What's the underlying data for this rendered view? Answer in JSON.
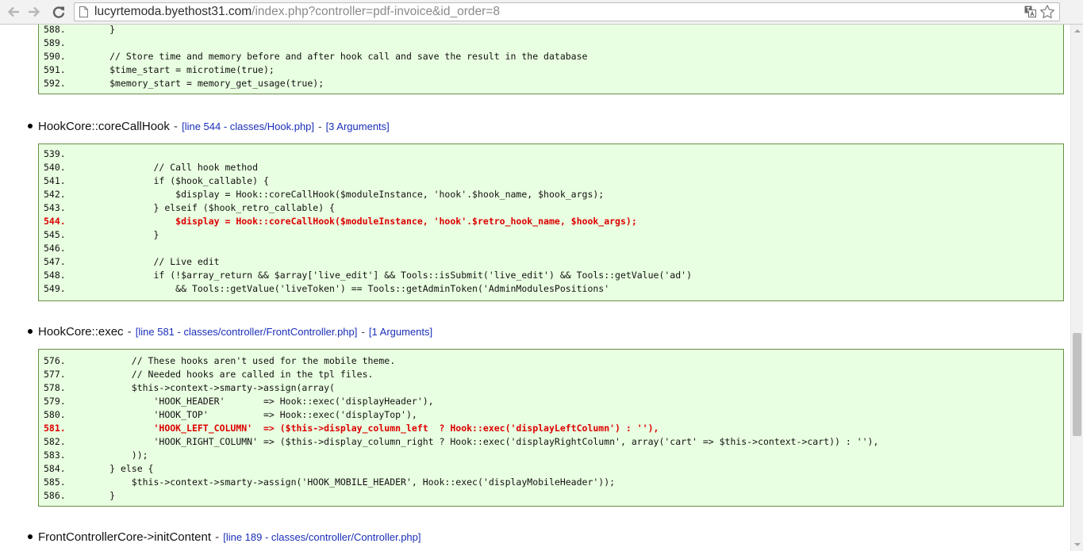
{
  "browser": {
    "url_host": "lucyrtemoda.byethost31.com",
    "url_path": "/index.php?controller=pdf-invoice&id_order=8",
    "icons": {
      "back": "back-arrow-icon",
      "forward": "forward-arrow-icon",
      "reload": "reload-icon",
      "page": "page-icon",
      "translate": "translate-icon",
      "bookmark": "star-icon"
    }
  },
  "frames": [
    {
      "lines": [
        {
          "num": "588.",
          "code": "        }",
          "highlight": false
        },
        {
          "num": "589.",
          "code": "",
          "highlight": false
        },
        {
          "num": "590.",
          "code": "        // Store time and memory before and after hook call and save the result in the database",
          "highlight": false
        },
        {
          "num": "591.",
          "code": "        $time_start = microtime(true);",
          "highlight": false
        },
        {
          "num": "592.",
          "code": "        $memory_start = memory_get_usage(true);",
          "highlight": false
        }
      ]
    },
    {
      "function": "HookCore::coreCallHook",
      "separator": "-",
      "file_link": "[line 544 - classes/Hook.php]",
      "link_separator": "-",
      "args_link": "[3 Arguments]",
      "lines": [
        {
          "num": "539.",
          "code": "",
          "highlight": false
        },
        {
          "num": "540.",
          "code": "                // Call hook method",
          "highlight": false
        },
        {
          "num": "541.",
          "code": "                if ($hook_callable) {",
          "highlight": false
        },
        {
          "num": "542.",
          "code": "                    $display = Hook::coreCallHook($moduleInstance, 'hook'.$hook_name, $hook_args);",
          "highlight": false
        },
        {
          "num": "543.",
          "code": "                } elseif ($hook_retro_callable) {",
          "highlight": false
        },
        {
          "num": "544.",
          "code": "                    $display = Hook::coreCallHook($moduleInstance, 'hook'.$retro_hook_name, $hook_args);",
          "highlight": true
        },
        {
          "num": "545.",
          "code": "                }",
          "highlight": false
        },
        {
          "num": "546.",
          "code": "",
          "highlight": false
        },
        {
          "num": "547.",
          "code": "                // Live edit",
          "highlight": false
        },
        {
          "num": "548.",
          "code": "                if (!$array_return && $array['live_edit'] && Tools::isSubmit('live_edit') && Tools::getValue('ad')",
          "highlight": false
        },
        {
          "num": "549.",
          "code": "                    && Tools::getValue('liveToken') == Tools::getAdminToken('AdminModulesPositions'",
          "highlight": false
        }
      ]
    },
    {
      "function": "HookCore::exec",
      "separator": "-",
      "file_link": "[line 581 - classes/controller/FrontController.php]",
      "link_separator": "-",
      "args_link": "[1 Arguments]",
      "lines": [
        {
          "num": "576.",
          "code": "            // These hooks aren't used for the mobile theme.",
          "highlight": false
        },
        {
          "num": "577.",
          "code": "            // Needed hooks are called in the tpl files.",
          "highlight": false
        },
        {
          "num": "578.",
          "code": "            $this->context->smarty->assign(array(",
          "highlight": false
        },
        {
          "num": "579.",
          "code": "                'HOOK_HEADER'       => Hook::exec('displayHeader'),",
          "highlight": false
        },
        {
          "num": "580.",
          "code": "                'HOOK_TOP'          => Hook::exec('displayTop'),",
          "highlight": false
        },
        {
          "num": "581.",
          "code": "                'HOOK_LEFT_COLUMN'  => ($this->display_column_left  ? Hook::exec('displayLeftColumn') : ''),",
          "highlight": true
        },
        {
          "num": "582.",
          "code": "                'HOOK_RIGHT_COLUMN' => ($this->display_column_right ? Hook::exec('displayRightColumn', array('cart' => $this->context->cart)) : ''),",
          "highlight": false
        },
        {
          "num": "583.",
          "code": "            ));",
          "highlight": false
        },
        {
          "num": "584.",
          "code": "        } else {",
          "highlight": false
        },
        {
          "num": "585.",
          "code": "            $this->context->smarty->assign('HOOK_MOBILE_HEADER', Hook::exec('displayMobileHeader'));",
          "highlight": false
        },
        {
          "num": "586.",
          "code": "        }",
          "highlight": false
        }
      ]
    },
    {
      "function": "FrontControllerCore->initContent",
      "separator": "-",
      "file_link": "[line 189 - classes/controller/Controller.php]"
    }
  ]
}
